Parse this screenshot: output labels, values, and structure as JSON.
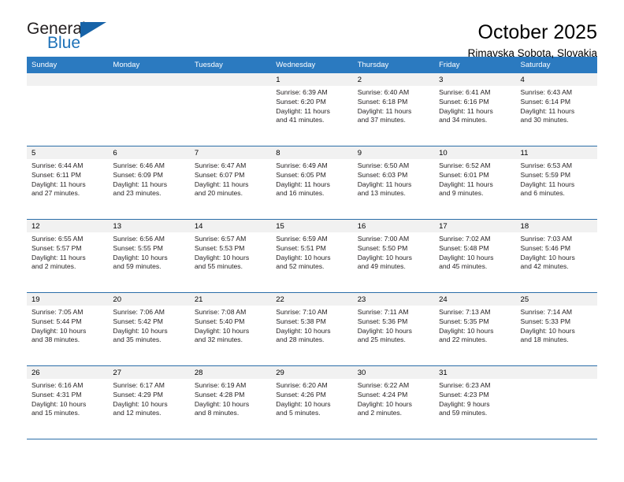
{
  "brand": {
    "name_part1": "General",
    "name_part2": "Blue",
    "flag_icon": "triangle-flag-icon",
    "accent_color": "#1763a8"
  },
  "header": {
    "month_title": "October 2025",
    "location": "Rimavska Sobota, Slovakia"
  },
  "theme": {
    "header_row_bg": "#2b7ac0",
    "grid_line": "#2b6ea8",
    "datestrip_bg": "#f1f1f1"
  },
  "calendar": {
    "day_headers": [
      "Sunday",
      "Monday",
      "Tuesday",
      "Wednesday",
      "Thursday",
      "Friday",
      "Saturday"
    ],
    "labels": {
      "sunrise": "Sunrise:",
      "sunset": "Sunset:",
      "daylight": "Daylight:"
    },
    "weeks": [
      [
        {
          "date": "",
          "empty": true
        },
        {
          "date": "",
          "empty": true
        },
        {
          "date": "",
          "empty": true
        },
        {
          "date": "1",
          "sunrise": "Sunrise: 6:39 AM",
          "sunset": "Sunset: 6:20 PM",
          "daylight_line1": "Daylight: 11 hours",
          "daylight_line2": "and 41 minutes."
        },
        {
          "date": "2",
          "sunrise": "Sunrise: 6:40 AM",
          "sunset": "Sunset: 6:18 PM",
          "daylight_line1": "Daylight: 11 hours",
          "daylight_line2": "and 37 minutes."
        },
        {
          "date": "3",
          "sunrise": "Sunrise: 6:41 AM",
          "sunset": "Sunset: 6:16 PM",
          "daylight_line1": "Daylight: 11 hours",
          "daylight_line2": "and 34 minutes."
        },
        {
          "date": "4",
          "sunrise": "Sunrise: 6:43 AM",
          "sunset": "Sunset: 6:14 PM",
          "daylight_line1": "Daylight: 11 hours",
          "daylight_line2": "and 30 minutes."
        }
      ],
      [
        {
          "date": "5",
          "sunrise": "Sunrise: 6:44 AM",
          "sunset": "Sunset: 6:11 PM",
          "daylight_line1": "Daylight: 11 hours",
          "daylight_line2": "and 27 minutes."
        },
        {
          "date": "6",
          "sunrise": "Sunrise: 6:46 AM",
          "sunset": "Sunset: 6:09 PM",
          "daylight_line1": "Daylight: 11 hours",
          "daylight_line2": "and 23 minutes."
        },
        {
          "date": "7",
          "sunrise": "Sunrise: 6:47 AM",
          "sunset": "Sunset: 6:07 PM",
          "daylight_line1": "Daylight: 11 hours",
          "daylight_line2": "and 20 minutes."
        },
        {
          "date": "8",
          "sunrise": "Sunrise: 6:49 AM",
          "sunset": "Sunset: 6:05 PM",
          "daylight_line1": "Daylight: 11 hours",
          "daylight_line2": "and 16 minutes."
        },
        {
          "date": "9",
          "sunrise": "Sunrise: 6:50 AM",
          "sunset": "Sunset: 6:03 PM",
          "daylight_line1": "Daylight: 11 hours",
          "daylight_line2": "and 13 minutes."
        },
        {
          "date": "10",
          "sunrise": "Sunrise: 6:52 AM",
          "sunset": "Sunset: 6:01 PM",
          "daylight_line1": "Daylight: 11 hours",
          "daylight_line2": "and 9 minutes."
        },
        {
          "date": "11",
          "sunrise": "Sunrise: 6:53 AM",
          "sunset": "Sunset: 5:59 PM",
          "daylight_line1": "Daylight: 11 hours",
          "daylight_line2": "and 6 minutes."
        }
      ],
      [
        {
          "date": "12",
          "sunrise": "Sunrise: 6:55 AM",
          "sunset": "Sunset: 5:57 PM",
          "daylight_line1": "Daylight: 11 hours",
          "daylight_line2": "and 2 minutes."
        },
        {
          "date": "13",
          "sunrise": "Sunrise: 6:56 AM",
          "sunset": "Sunset: 5:55 PM",
          "daylight_line1": "Daylight: 10 hours",
          "daylight_line2": "and 59 minutes."
        },
        {
          "date": "14",
          "sunrise": "Sunrise: 6:57 AM",
          "sunset": "Sunset: 5:53 PM",
          "daylight_line1": "Daylight: 10 hours",
          "daylight_line2": "and 55 minutes."
        },
        {
          "date": "15",
          "sunrise": "Sunrise: 6:59 AM",
          "sunset": "Sunset: 5:51 PM",
          "daylight_line1": "Daylight: 10 hours",
          "daylight_line2": "and 52 minutes."
        },
        {
          "date": "16",
          "sunrise": "Sunrise: 7:00 AM",
          "sunset": "Sunset: 5:50 PM",
          "daylight_line1": "Daylight: 10 hours",
          "daylight_line2": "and 49 minutes."
        },
        {
          "date": "17",
          "sunrise": "Sunrise: 7:02 AM",
          "sunset": "Sunset: 5:48 PM",
          "daylight_line1": "Daylight: 10 hours",
          "daylight_line2": "and 45 minutes."
        },
        {
          "date": "18",
          "sunrise": "Sunrise: 7:03 AM",
          "sunset": "Sunset: 5:46 PM",
          "daylight_line1": "Daylight: 10 hours",
          "daylight_line2": "and 42 minutes."
        }
      ],
      [
        {
          "date": "19",
          "sunrise": "Sunrise: 7:05 AM",
          "sunset": "Sunset: 5:44 PM",
          "daylight_line1": "Daylight: 10 hours",
          "daylight_line2": "and 38 minutes."
        },
        {
          "date": "20",
          "sunrise": "Sunrise: 7:06 AM",
          "sunset": "Sunset: 5:42 PM",
          "daylight_line1": "Daylight: 10 hours",
          "daylight_line2": "and 35 minutes."
        },
        {
          "date": "21",
          "sunrise": "Sunrise: 7:08 AM",
          "sunset": "Sunset: 5:40 PM",
          "daylight_line1": "Daylight: 10 hours",
          "daylight_line2": "and 32 minutes."
        },
        {
          "date": "22",
          "sunrise": "Sunrise: 7:10 AM",
          "sunset": "Sunset: 5:38 PM",
          "daylight_line1": "Daylight: 10 hours",
          "daylight_line2": "and 28 minutes."
        },
        {
          "date": "23",
          "sunrise": "Sunrise: 7:11 AM",
          "sunset": "Sunset: 5:36 PM",
          "daylight_line1": "Daylight: 10 hours",
          "daylight_line2": "and 25 minutes."
        },
        {
          "date": "24",
          "sunrise": "Sunrise: 7:13 AM",
          "sunset": "Sunset: 5:35 PM",
          "daylight_line1": "Daylight: 10 hours",
          "daylight_line2": "and 22 minutes."
        },
        {
          "date": "25",
          "sunrise": "Sunrise: 7:14 AM",
          "sunset": "Sunset: 5:33 PM",
          "daylight_line1": "Daylight: 10 hours",
          "daylight_line2": "and 18 minutes."
        }
      ],
      [
        {
          "date": "26",
          "sunrise": "Sunrise: 6:16 AM",
          "sunset": "Sunset: 4:31 PM",
          "daylight_line1": "Daylight: 10 hours",
          "daylight_line2": "and 15 minutes."
        },
        {
          "date": "27",
          "sunrise": "Sunrise: 6:17 AM",
          "sunset": "Sunset: 4:29 PM",
          "daylight_line1": "Daylight: 10 hours",
          "daylight_line2": "and 12 minutes."
        },
        {
          "date": "28",
          "sunrise": "Sunrise: 6:19 AM",
          "sunset": "Sunset: 4:28 PM",
          "daylight_line1": "Daylight: 10 hours",
          "daylight_line2": "and 8 minutes."
        },
        {
          "date": "29",
          "sunrise": "Sunrise: 6:20 AM",
          "sunset": "Sunset: 4:26 PM",
          "daylight_line1": "Daylight: 10 hours",
          "daylight_line2": "and 5 minutes."
        },
        {
          "date": "30",
          "sunrise": "Sunrise: 6:22 AM",
          "sunset": "Sunset: 4:24 PM",
          "daylight_line1": "Daylight: 10 hours",
          "daylight_line2": "and 2 minutes."
        },
        {
          "date": "31",
          "sunrise": "Sunrise: 6:23 AM",
          "sunset": "Sunset: 4:23 PM",
          "daylight_line1": "Daylight: 9 hours",
          "daylight_line2": "and 59 minutes."
        },
        {
          "date": "",
          "empty": true
        }
      ]
    ]
  }
}
